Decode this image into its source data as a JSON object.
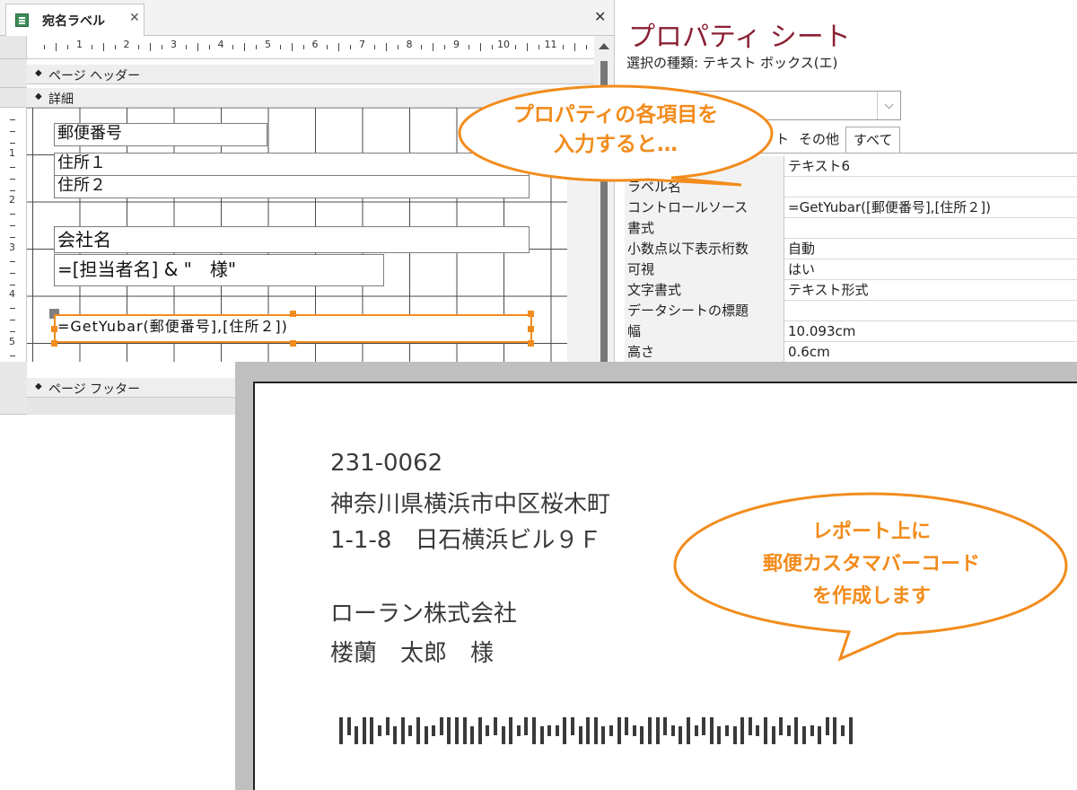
{
  "designer": {
    "tab_title": "宛名ラベル",
    "tab_close_glyph": "✕",
    "window_close_glyph": "✕",
    "ruler_numbers": [
      "1",
      "2",
      "3",
      "4",
      "5",
      "6",
      "7",
      "8",
      "9",
      "10",
      "11"
    ],
    "left_ruler_numbers": [
      "1",
      "2",
      "3",
      "4",
      "5"
    ],
    "sections": {
      "page_header": "ページ ヘッダー",
      "detail": "詳細",
      "page_footer": "ページ フッター"
    },
    "controls": {
      "postal_code": "郵便番号",
      "address1": "住所１",
      "address2": "住所２",
      "company": "会社名",
      "contact": "=[担当者名] & \"　様\"",
      "barcode_expr": "=GetYubar(郵便番号],[住所２])"
    }
  },
  "property_sheet": {
    "title": "プロパティ シート",
    "selection_type": "選択の種類: テキスト ボックス(エ)",
    "tabs": [
      "ト",
      "その他",
      "すべて"
    ],
    "active_tab": "すべて",
    "rows": [
      {
        "name": "",
        "value": "テキスト6"
      },
      {
        "name": "ラベル名",
        "value": ""
      },
      {
        "name": "コントロールソース",
        "value": "=GetYubar([郵便番号],[住所２])"
      },
      {
        "name": "書式",
        "value": ""
      },
      {
        "name": "小数点以下表示桁数",
        "value": "自動"
      },
      {
        "name": "可視",
        "value": "はい"
      },
      {
        "name": "文字書式",
        "value": "テキスト形式"
      },
      {
        "name": "データシートの標題",
        "value": ""
      },
      {
        "name": "幅",
        "value": "10.093cm"
      },
      {
        "name": "高さ",
        "value": "0.6cm"
      }
    ]
  },
  "label_preview": {
    "postal_code": "231-0062",
    "address1": "神奈川県横浜市中区桜木町",
    "address2": "1-1-8　日石横浜ビル９Ｆ",
    "company": "ローラン株式会社",
    "contact": "楼蘭　太郎　様"
  },
  "callouts": {
    "top": [
      "プロパティの各項目を",
      "入力すると…"
    ],
    "bottom": [
      "レポート上に",
      "郵便カスタマバーコード",
      "を作成します"
    ]
  },
  "colors": {
    "accent_orange": "#f28c1c",
    "title_red": "#8b2033"
  }
}
